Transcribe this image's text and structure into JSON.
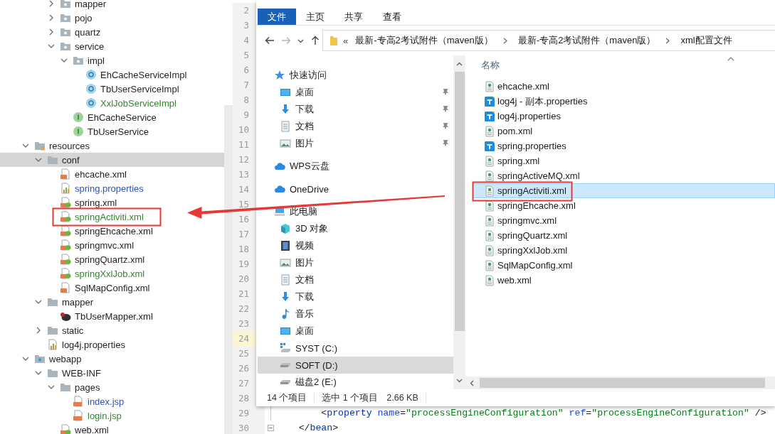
{
  "tree": {
    "items": [
      {
        "children": [
          {
            "children": [
              {
                "label": "mapper",
                "kind": "package",
                "expanded": false,
                "selected": false,
                "color": "#1f1f1f"
              },
              {
                "label": "pojo",
                "kind": "package",
                "expanded": false,
                "selected": false,
                "color": "#1f1f1f"
              },
              {
                "label": "quartz",
                "kind": "package",
                "expanded": false,
                "selected": false,
                "color": "#1f1f1f"
              },
              {
                "label": "service",
                "kind": "package",
                "expanded": true,
                "selected": false,
                "color": "#1f1f1f",
                "children": [
                  {
                    "label": "impl",
                    "kind": "package",
                    "expanded": true,
                    "selected": false,
                    "color": "#1f1f1f",
                    "children": [
                      {
                        "label": "EhCacheServiceImpl",
                        "kind": "class",
                        "selected": false,
                        "color": "#1f1f1f"
                      },
                      {
                        "label": "TbUserServiceImpl",
                        "kind": "class",
                        "selected": false,
                        "color": "#1f1f1f"
                      },
                      {
                        "label": "XxlJobServiceImpl",
                        "kind": "class",
                        "selected": false,
                        "color": "#2f8a2a"
                      }
                    ]
                  },
                  {
                    "label": "EhCacheService",
                    "kind": "interface",
                    "selected": false,
                    "color": "#1f1f1f"
                  },
                  {
                    "label": "TbUserService",
                    "kind": "interface",
                    "selected": false,
                    "color": "#1f1f1f"
                  }
                ]
              }
            ]
          }
        ]
      },
      {
        "label": "resources",
        "kind": "resources-root",
        "expanded": true,
        "selected": false,
        "color": "#1f1f1f",
        "children": [
          {
            "label": "conf",
            "kind": "folder",
            "expanded": true,
            "selected": true,
            "color": "#1f1f1f",
            "children": [
              {
                "label": "ehcache.xml",
                "kind": "xml",
                "selected": false,
                "color": "#1f1f1f"
              },
              {
                "label": "spring.properties",
                "kind": "properties",
                "selected": false,
                "color": "#2a54b8"
              },
              {
                "label": "spring.xml",
                "kind": "spring",
                "selected": false,
                "color": "#1f1f1f"
              },
              {
                "label": "springActiviti.xml",
                "kind": "spring",
                "selected": false,
                "color": "#2f8a2a"
              },
              {
                "label": "springEhcache.xml",
                "kind": "spring",
                "selected": false,
                "color": "#1f1f1f"
              },
              {
                "label": "springmvc.xml",
                "kind": "spring",
                "selected": false,
                "color": "#1f1f1f"
              },
              {
                "label": "springQuartz.xml",
                "kind": "spring",
                "selected": false,
                "color": "#1f1f1f"
              },
              {
                "label": "springXxlJob.xml",
                "kind": "spring",
                "selected": false,
                "color": "#2f8a2a"
              },
              {
                "label": "SqlMapConfig.xml",
                "kind": "xml",
                "selected": false,
                "color": "#1f1f1f"
              }
            ]
          },
          {
            "label": "mapper",
            "kind": "folder",
            "expanded": true,
            "selected": false,
            "color": "#1f1f1f",
            "children": [
              {
                "label": "TbUserMapper.xml",
                "kind": "mybatis",
                "selected": false,
                "color": "#1f1f1f"
              }
            ]
          },
          {
            "label": "static",
            "kind": "folder",
            "expanded": false,
            "selected": false,
            "color": "#1f1f1f"
          },
          {
            "label": "log4j.properties",
            "kind": "properties",
            "selected": false,
            "color": "#1f1f1f"
          }
        ]
      },
      {
        "label": "webapp",
        "kind": "web-root",
        "expanded": true,
        "selected": false,
        "color": "#1f1f1f",
        "children": [
          {
            "label": "WEB-INF",
            "kind": "folder",
            "expanded": true,
            "selected": false,
            "color": "#1f1f1f",
            "children": [
              {
                "label": "pages",
                "kind": "folder",
                "expanded": true,
                "selected": false,
                "color": "#1f1f1f",
                "children": [
                  {
                    "label": "index.jsp",
                    "kind": "jsp",
                    "selected": false,
                    "color": "#2a54b8"
                  },
                  {
                    "label": "login.jsp",
                    "kind": "jsp",
                    "selected": false,
                    "color": "#2f8a2a"
                  }
                ]
              },
              {
                "label": "web.xml",
                "kind": "spring",
                "selected": false,
                "color": "#1f1f1f"
              }
            ]
          }
        ]
      }
    ]
  },
  "editor": {
    "lines": [
      {
        "number": "2",
        "current": false
      },
      {
        "number": "3",
        "current": false
      },
      {
        "number": "4",
        "current": false
      },
      {
        "number": "5",
        "current": false
      },
      {
        "number": "6",
        "current": false
      },
      {
        "number": "7",
        "current": false
      },
      {
        "number": "8",
        "current": false
      },
      {
        "number": "9",
        "current": false
      },
      {
        "number": "10",
        "current": false
      },
      {
        "number": "11",
        "current": false
      },
      {
        "number": "12",
        "current": false
      },
      {
        "number": "13",
        "current": false
      },
      {
        "number": "14",
        "current": false
      },
      {
        "number": "15",
        "current": false
      },
      {
        "number": "16",
        "current": false
      },
      {
        "number": "17",
        "current": false
      },
      {
        "number": "18",
        "current": false
      },
      {
        "number": "19",
        "current": false
      },
      {
        "number": "20",
        "current": false
      },
      {
        "number": "21",
        "current": false
      },
      {
        "number": "22",
        "current": false
      },
      {
        "number": "23",
        "current": false
      },
      {
        "number": "24",
        "current": true
      },
      {
        "number": "25",
        "current": false
      },
      {
        "number": "26",
        "current": false
      },
      {
        "number": "27",
        "current": false
      },
      {
        "number": "28",
        "current": false
      },
      {
        "number": "29",
        "current": false,
        "foldable": false,
        "code": [
          {
            "text": "        <",
            "kind": "punct"
          },
          {
            "text": "property",
            "kind": "tag"
          },
          {
            "text": " name",
            "kind": "attr"
          },
          {
            "text": "=",
            "kind": "punct"
          },
          {
            "text": "\"processEngineConfiguration\"",
            "kind": "value"
          },
          {
            "text": " ref",
            "kind": "attr"
          },
          {
            "text": "=",
            "kind": "punct"
          },
          {
            "text": "\"processEngineConfiguration\"",
            "kind": "value"
          },
          {
            "text": " />",
            "kind": "punct"
          }
        ]
      },
      {
        "number": "30",
        "current": false,
        "foldable": true,
        "code": [
          {
            "text": "    </",
            "kind": "punct"
          },
          {
            "text": "bean",
            "kind": "tag"
          },
          {
            "text": ">",
            "kind": "punct"
          }
        ]
      }
    ]
  },
  "explorer": {
    "ribbon_tabs": [
      {
        "label": "文件",
        "selected": true
      },
      {
        "label": "主页",
        "selected": false
      },
      {
        "label": "共享",
        "selected": false
      },
      {
        "label": "查看",
        "selected": false
      }
    ],
    "address": {
      "overflow": "«",
      "crumbs": [
        "最新-专高2考试附件（maven版）",
        "最新-专高2考试附件（maven版）",
        "xml配置文件"
      ]
    },
    "nav": [
      {
        "label": "快速访问",
        "kind": "star",
        "selected": false,
        "pinned": false,
        "children": [
          {
            "label": "桌面",
            "kind": "desktop",
            "selected": false,
            "pinned": true
          },
          {
            "label": "下载",
            "kind": "download",
            "selected": false,
            "pinned": true
          },
          {
            "label": "文档",
            "kind": "document",
            "selected": false,
            "pinned": true
          },
          {
            "label": "图片",
            "kind": "picture",
            "selected": false,
            "pinned": true
          }
        ]
      },
      {
        "label": "WPS云盘",
        "kind": "cloud",
        "selected": false,
        "pinned": false
      },
      {
        "label": "OneDrive",
        "kind": "cloud",
        "selected": false,
        "pinned": false
      },
      {
        "label": "此电脑",
        "kind": "computer",
        "selected": false,
        "pinned": false,
        "children": [
          {
            "label": "3D 对象",
            "kind": "cube",
            "selected": false,
            "pinned": false
          },
          {
            "label": "视频",
            "kind": "video",
            "selected": false,
            "pinned": false
          },
          {
            "label": "图片",
            "kind": "picture",
            "selected": false,
            "pinned": false
          },
          {
            "label": "文档",
            "kind": "document",
            "selected": false,
            "pinned": false
          },
          {
            "label": "下载",
            "kind": "download",
            "selected": false,
            "pinned": false
          },
          {
            "label": "音乐",
            "kind": "music",
            "selected": false,
            "pinned": false
          },
          {
            "label": "桌面",
            "kind": "desktop",
            "selected": false,
            "pinned": false
          },
          {
            "label": "SYST (C:)",
            "kind": "system-drive",
            "selected": false,
            "pinned": false
          },
          {
            "label": "SOFT (D:)",
            "kind": "drive",
            "selected": true,
            "pinned": false
          },
          {
            "label": "磁盘2 (E:)",
            "kind": "drive",
            "selected": false,
            "pinned": false
          }
        ]
      }
    ],
    "column_header": "名称",
    "files": [
      {
        "name": "ehcache.xml",
        "kind": "xml",
        "selected": false
      },
      {
        "name": "log4j - 副本.properties",
        "kind": "text",
        "selected": false
      },
      {
        "name": "log4j.properties",
        "kind": "text",
        "selected": false
      },
      {
        "name": "pom.xml",
        "kind": "xml",
        "selected": false
      },
      {
        "name": "spring.properties",
        "kind": "text",
        "selected": false
      },
      {
        "name": "spring.xml",
        "kind": "xml",
        "selected": false
      },
      {
        "name": "springActiveMQ.xml",
        "kind": "xml",
        "selected": false
      },
      {
        "name": "springActiviti.xml",
        "kind": "xml",
        "selected": true
      },
      {
        "name": "springEhcache.xml",
        "kind": "xml",
        "selected": false
      },
      {
        "name": "springmvc.xml",
        "kind": "xml",
        "selected": false
      },
      {
        "name": "springQuartz.xml",
        "kind": "xml",
        "selected": false
      },
      {
        "name": "springXxlJob.xml",
        "kind": "xml",
        "selected": false
      },
      {
        "name": "SqlMapConfig.xml",
        "kind": "xml",
        "selected": false
      },
      {
        "name": "web.xml",
        "kind": "xml",
        "selected": false
      }
    ],
    "status": {
      "item_count": "14 个项目",
      "selection": "选中 1 个项目",
      "size": "2.66 KB"
    }
  }
}
